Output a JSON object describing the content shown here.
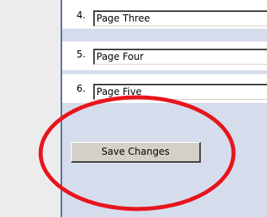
{
  "list": {
    "items": [
      {
        "number": "4.",
        "value": "Page Three"
      },
      {
        "number": "5.",
        "value": "Page Four"
      },
      {
        "number": "6.",
        "value": "Page Five"
      }
    ]
  },
  "actions": {
    "save_label": "Save Changes"
  },
  "colors": {
    "panel_bg": "#d5dcec",
    "highlight": "#e8141c",
    "button_face": "#d4d0c8"
  }
}
